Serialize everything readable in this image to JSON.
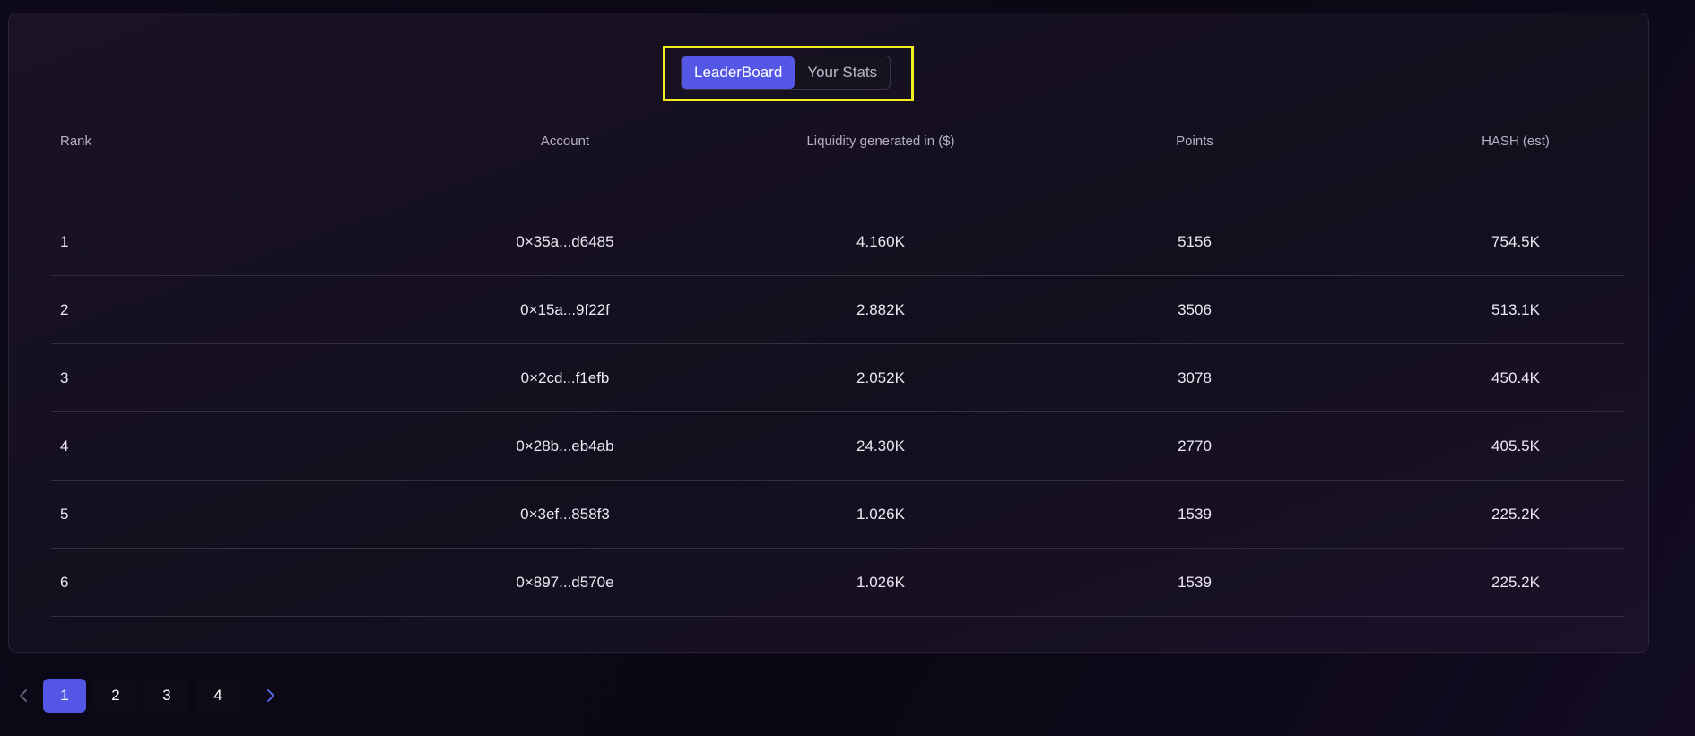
{
  "tabs": [
    {
      "label": "LeaderBoard",
      "active": true
    },
    {
      "label": "Your Stats",
      "active": false
    }
  ],
  "table": {
    "headers": {
      "rank": "Rank",
      "account": "Account",
      "liquidity": "Liquidity generated in ($)",
      "points": "Points",
      "hash": "HASH (est)"
    },
    "rows": [
      {
        "rank": "1",
        "account": "0×35a...d6485",
        "liquidity": "4.160K",
        "points": "5156",
        "hash": "754.5K"
      },
      {
        "rank": "2",
        "account": "0×15a...9f22f",
        "liquidity": "2.882K",
        "points": "3506",
        "hash": "513.1K"
      },
      {
        "rank": "3",
        "account": "0×2cd...f1efb",
        "liquidity": "2.052K",
        "points": "3078",
        "hash": "450.4K"
      },
      {
        "rank": "4",
        "account": "0×28b...eb4ab",
        "liquidity": "24.30K",
        "points": "2770",
        "hash": "405.5K"
      },
      {
        "rank": "5",
        "account": "0×3ef...858f3",
        "liquidity": "1.026K",
        "points": "1539",
        "hash": "225.2K"
      },
      {
        "rank": "6",
        "account": "0×897...d570e",
        "liquidity": "1.026K",
        "points": "1539",
        "hash": "225.2K"
      }
    ]
  },
  "pagination": {
    "prev_icon": "chevron-left-icon",
    "next_icon": "chevron-right-icon",
    "pages": [
      "1",
      "2",
      "3",
      "4"
    ],
    "current": "1",
    "colors": {
      "active": "#5457e6",
      "next_arrow": "#5a6cf0"
    }
  }
}
